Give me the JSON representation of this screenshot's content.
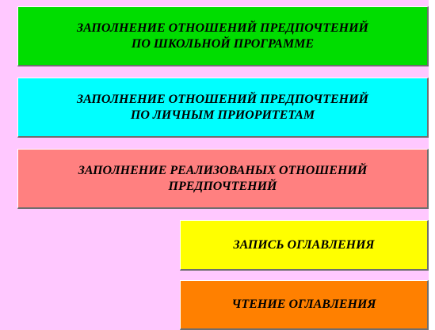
{
  "colors": {
    "background": "#ffc8ff",
    "school_button": "#00dd00",
    "personal_button": "#00ffff",
    "realized_button": "#ff8080",
    "write_button": "#ffff00",
    "read_button": "#ff8000"
  },
  "buttons": {
    "school": {
      "line1": "ЗАПОЛНЕНИЕ ОТНОШЕНИЙ ПРЕДПОЧТЕНИЙ",
      "line2": "ПО ШКОЛЬНОЙ ПРОГРАММЕ"
    },
    "personal": {
      "line1": "ЗАПОЛНЕНИЕ ОТНОШЕНИЙ ПРЕДПОЧТЕНИЙ",
      "line2": "ПО ЛИЧНЫМ ПРИОРИТЕТАМ"
    },
    "realized": {
      "line1": "ЗАПОЛНЕНИЕ РЕАЛИЗОВАНЫХ ОТНОШЕНИЙ",
      "line2": "ПРЕДПОЧТЕНИЙ"
    },
    "write_toc": {
      "label": "ЗАПИСЬ ОГЛАВЛЕНИЯ"
    },
    "read_toc": {
      "label": "ЧТЕНИЕ  ОГЛАВЛЕНИЯ"
    }
  }
}
